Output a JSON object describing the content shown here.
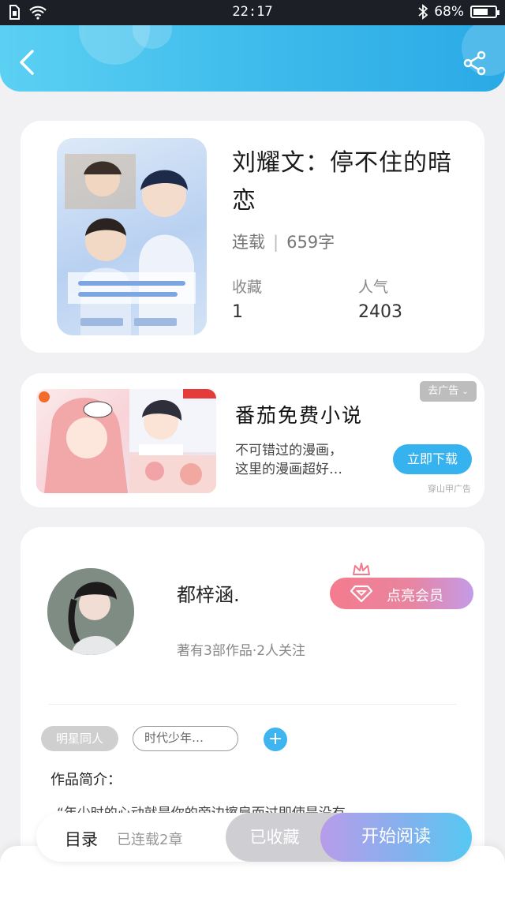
{
  "status_bar": {
    "time": "22:17",
    "battery": "68%",
    "battery_level": 0.68
  },
  "header": {
    "back_icon": "chevron-left-icon",
    "share_icon": "share-icon"
  },
  "book": {
    "title": "刘耀文：停不住的暗恋",
    "status": "连载",
    "word_count": "659字",
    "collect_label": "收藏",
    "collect_value": "1",
    "popularity_label": "人气",
    "popularity_value": "2403"
  },
  "ad": {
    "title": "番茄免费小说",
    "desc_line1": "不可错过的漫画，",
    "desc_line2": "这里的漫画超好…",
    "close_label": "去广告",
    "download_label": "立即下载",
    "source": "穿山甲广告"
  },
  "author": {
    "name": "都梓涵.",
    "info": "著有3部作品·2人关注",
    "vip_label": "点亮会员",
    "tags": [
      "明星同人",
      "时代少年…"
    ],
    "intro_label": "作品简介：",
    "intro_text": "“年少时的心动就是你的旁边擦肩而过即使是没有"
  },
  "bottom": {
    "toc_label": "目录",
    "toc_count": "已连载2章",
    "collected_label": "已收藏",
    "read_label": "开始阅读"
  },
  "colors": {
    "accent": "#3ab8ea",
    "vip": "#f47b8e",
    "read": "#56c8f2"
  }
}
